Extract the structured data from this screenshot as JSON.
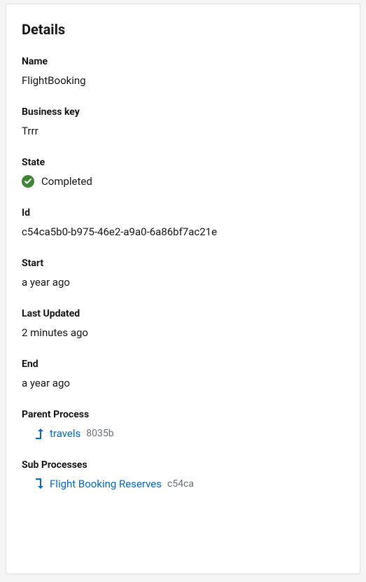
{
  "card": {
    "title": "Details"
  },
  "fields": {
    "name": {
      "label": "Name",
      "value": "FlightBooking"
    },
    "businessKey": {
      "label": "Business key",
      "value": "Trrr"
    },
    "state": {
      "label": "State",
      "value": "Completed"
    },
    "id": {
      "label": "Id",
      "value": "c54ca5b0-b975-46e2-a9a0-6a86bf7ac21e"
    },
    "start": {
      "label": "Start",
      "value": "a year ago"
    },
    "lastUpdated": {
      "label": "Last Updated",
      "value": "2 minutes ago"
    },
    "end": {
      "label": "End",
      "value": "a year ago"
    },
    "parentProcess": {
      "label": "Parent Process",
      "linkText": "travels",
      "idSuffix": "8035b"
    },
    "subProcesses": {
      "label": "Sub Processes",
      "linkText": "Flight Booking Reserves",
      "idSuffix": "c54ca"
    }
  }
}
